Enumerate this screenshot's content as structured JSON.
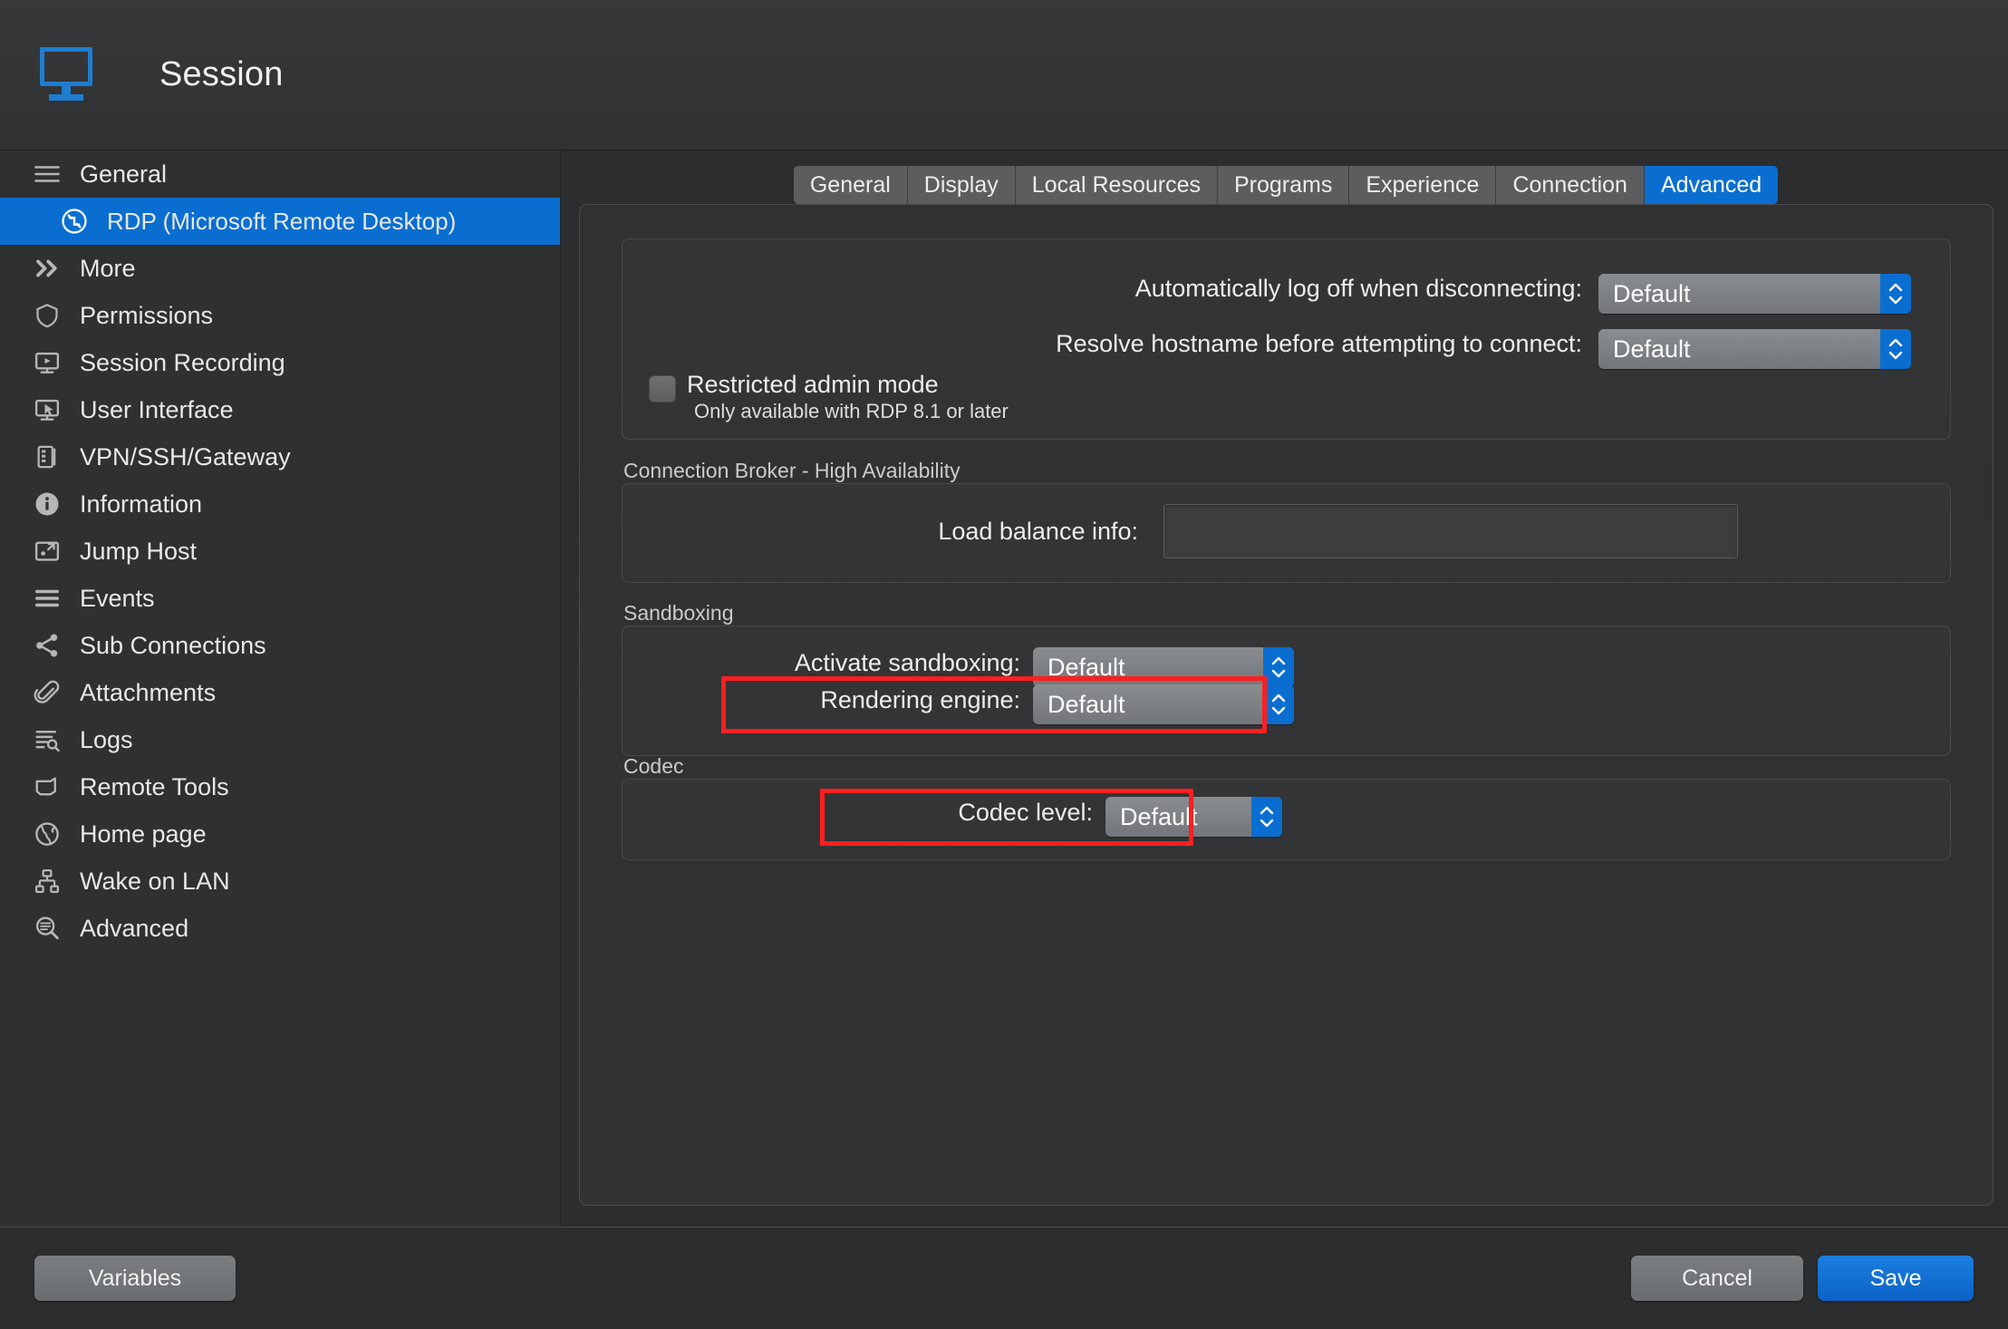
{
  "header": {
    "title": "Session",
    "icon": "monitor-icon"
  },
  "sidebar": {
    "items": [
      {
        "label": "General",
        "icon": "hamburger-icon",
        "level": "group",
        "selected": false
      },
      {
        "label": "RDP (Microsoft Remote Desktop)",
        "icon": "rdp-icon",
        "level": "child",
        "selected": true
      },
      {
        "label": "More",
        "icon": "double-chevron-right-icon",
        "level": "group",
        "selected": false
      },
      {
        "label": "Permissions",
        "icon": "shield-icon",
        "level": "group",
        "selected": false
      },
      {
        "label": "Session Recording",
        "icon": "monitor-play-icon",
        "level": "group",
        "selected": false
      },
      {
        "label": "User Interface",
        "icon": "monitor-cursor-icon",
        "level": "group",
        "selected": false
      },
      {
        "label": "VPN/SSH/Gateway",
        "icon": "server-icon",
        "level": "group",
        "selected": false
      },
      {
        "label": "Information",
        "icon": "info-circle-icon",
        "level": "group",
        "selected": false
      },
      {
        "label": "Jump Host",
        "icon": "jump-host-icon",
        "level": "group",
        "selected": false
      },
      {
        "label": "Events",
        "icon": "lines-icon",
        "level": "group",
        "selected": false
      },
      {
        "label": "Sub Connections",
        "icon": "share-nodes-icon",
        "level": "group",
        "selected": false
      },
      {
        "label": "Attachments",
        "icon": "paperclip-icon",
        "level": "group",
        "selected": false
      },
      {
        "label": "Logs",
        "icon": "log-search-icon",
        "level": "group",
        "selected": false
      },
      {
        "label": "Remote Tools",
        "icon": "arrow-banner-icon",
        "level": "group",
        "selected": false
      },
      {
        "label": "Home page",
        "icon": "globe-icon",
        "level": "group",
        "selected": false
      },
      {
        "label": "Wake on LAN",
        "icon": "network-icon",
        "level": "group",
        "selected": false
      },
      {
        "label": "Advanced",
        "icon": "magnifier-doc-icon",
        "level": "group",
        "selected": false
      }
    ]
  },
  "tabs": [
    {
      "label": "General",
      "active": false
    },
    {
      "label": "Display",
      "active": false
    },
    {
      "label": "Local Resources",
      "active": false
    },
    {
      "label": "Programs",
      "active": false
    },
    {
      "label": "Experience",
      "active": false
    },
    {
      "label": "Connection",
      "active": false
    },
    {
      "label": "Advanced",
      "active": true
    }
  ],
  "form": {
    "auto_logoff": {
      "label": "Automatically log off when disconnecting:",
      "value": "Default"
    },
    "resolve_hostname": {
      "label": "Resolve hostname before attempting to connect:",
      "value": "Default"
    },
    "restricted_admin": {
      "label": "Restricted admin mode",
      "hint": "Only available with RDP 8.1 or later",
      "checked": false
    },
    "connection_broker": {
      "section_label": "Connection Broker - High Availability",
      "load_balance": {
        "label": "Load balance info:",
        "value": "",
        "placeholder": ""
      }
    },
    "sandboxing": {
      "section_label": "Sandboxing",
      "activate": {
        "label": "Activate sandboxing:",
        "value": "Default"
      },
      "rendering_engine": {
        "label": "Rendering engine:",
        "value": "Default",
        "highlighted": true
      }
    },
    "codec": {
      "section_label": "Codec",
      "level": {
        "label": "Codec level:",
        "value": "Default",
        "highlighted": true
      }
    }
  },
  "footer": {
    "variables_label": "Variables",
    "cancel_label": "Cancel",
    "save_label": "Save"
  },
  "colors": {
    "accent": "#0a6ed1",
    "highlight": "#ff1f1f",
    "background": "#2b2d2f",
    "sidebar": "#2e3032"
  }
}
